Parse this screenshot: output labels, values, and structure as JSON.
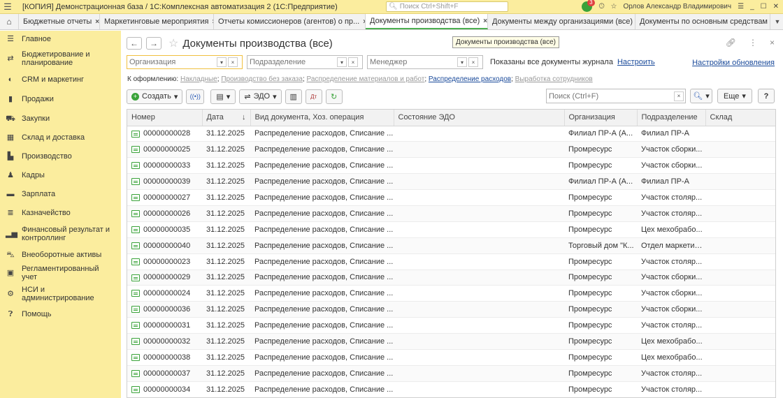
{
  "titlebar": {
    "menu_icon": "hamburger-icon",
    "title": "[КОПИЯ] Демонстрационная база / 1С:Комплексная автоматизация 2  (1С:Предприятие)",
    "search_placeholder": "Поиск Ctrl+Shift+F",
    "notifications_count": "3",
    "user": "Орлов Александр Владимирович"
  },
  "tabs": {
    "items": [
      {
        "label": "Бюджетные отчеты"
      },
      {
        "label": "Маркетинговые мероприятия"
      },
      {
        "label": "Отчеты комиссионеров (агентов) о пр..."
      },
      {
        "label": "Документы производства (все)"
      },
      {
        "label": "Документы между организациями (все)"
      },
      {
        "label": "Документы по основным средствам"
      }
    ],
    "active_index": 3
  },
  "sidebar": {
    "items": [
      {
        "label": "Главное",
        "icon": "menu-icon"
      },
      {
        "label": "Бюджетирование и планирование",
        "icon": "budget-icon"
      },
      {
        "label": "CRM и маркетинг",
        "icon": "crm-icon"
      },
      {
        "label": "Продажи",
        "icon": "sales-icon"
      },
      {
        "label": "Закупки",
        "icon": "cart-icon"
      },
      {
        "label": "Склад и доставка",
        "icon": "warehouse-icon"
      },
      {
        "label": "Производство",
        "icon": "factory-icon"
      },
      {
        "label": "Кадры",
        "icon": "person-icon"
      },
      {
        "label": "Зарплата",
        "icon": "wallet-icon"
      },
      {
        "label": "Казначейство",
        "icon": "treasury-icon"
      },
      {
        "label": "Финансовый результат и контроллинг",
        "icon": "chart-icon"
      },
      {
        "label": "Внеоборотные активы",
        "icon": "assets-icon"
      },
      {
        "label": "Регламентированный учет",
        "icon": "calculator-icon"
      },
      {
        "label": "НСИ и администрирование",
        "icon": "gear-icon"
      },
      {
        "label": "Помощь",
        "icon": "help-icon"
      }
    ]
  },
  "header": {
    "title": "Документы производства (все)",
    "tooltip": "Документы производства (все)"
  },
  "filters": {
    "organization_placeholder": "Организация",
    "department_placeholder": "Подразделение",
    "manager_placeholder": "Менеджер",
    "shown_text": "Показаны все документы журнала",
    "configure_link": "Настроить",
    "update_settings_link": "Настройки обновления"
  },
  "process": {
    "label": "К оформлению:",
    "items": [
      {
        "text": "Накладные"
      },
      {
        "text": "Производство без заказа"
      },
      {
        "text": "Распределение материалов и работ"
      },
      {
        "text": "Распределение расходов"
      },
      {
        "text": "Выработка сотрудников"
      }
    ],
    "active_index": 3
  },
  "toolbar": {
    "create_label": "Создать",
    "edo_label": "ЭДО",
    "search_placeholder": "Поиск (Ctrl+F)",
    "more_label": "Еще",
    "help_label": "?"
  },
  "table": {
    "columns": [
      "Номер",
      "Дата",
      "Вид документа, Хоз. операция",
      "Состояние ЭДО",
      "Организация",
      "Подразделение",
      "Склад"
    ],
    "rows": [
      {
        "number": "00000000028",
        "date": "31.12.2025",
        "type": "Распределение расходов, Списание ...",
        "edo": "",
        "org": "Филиал ПР-А (А...",
        "dept": "Филиал ПР-А",
        "store": ""
      },
      {
        "number": "00000000025",
        "date": "31.12.2025",
        "type": "Распределение расходов, Списание ...",
        "edo": "",
        "org": "Промресурс",
        "dept": "Участок сборки...",
        "store": ""
      },
      {
        "number": "00000000033",
        "date": "31.12.2025",
        "type": "Распределение расходов, Списание ...",
        "edo": "",
        "org": "Промресурс",
        "dept": "Участок сборки...",
        "store": ""
      },
      {
        "number": "00000000039",
        "date": "31.12.2025",
        "type": "Распределение расходов, Списание ...",
        "edo": "",
        "org": "Филиал ПР-А (А...",
        "dept": "Филиал ПР-А",
        "store": ""
      },
      {
        "number": "00000000027",
        "date": "31.12.2025",
        "type": "Распределение расходов, Списание ...",
        "edo": "",
        "org": "Промресурс",
        "dept": "Участок столяр...",
        "store": ""
      },
      {
        "number": "00000000026",
        "date": "31.12.2025",
        "type": "Распределение расходов, Списание ...",
        "edo": "",
        "org": "Промресурс",
        "dept": "Участок столяр...",
        "store": ""
      },
      {
        "number": "00000000035",
        "date": "31.12.2025",
        "type": "Распределение расходов, Списание ...",
        "edo": "",
        "org": "Промресурс",
        "dept": "Цех мехобрабо...",
        "store": ""
      },
      {
        "number": "00000000040",
        "date": "31.12.2025",
        "type": "Распределение расходов, Списание ...",
        "edo": "",
        "org": "Торговый дом \"К...",
        "dept": "Отдел маркетинга",
        "store": ""
      },
      {
        "number": "00000000023",
        "date": "31.12.2025",
        "type": "Распределение расходов, Списание ...",
        "edo": "",
        "org": "Промресурс",
        "dept": "Участок столяр...",
        "store": ""
      },
      {
        "number": "00000000029",
        "date": "31.12.2025",
        "type": "Распределение расходов, Списание ...",
        "edo": "",
        "org": "Промресурс",
        "dept": "Участок сборки...",
        "store": ""
      },
      {
        "number": "00000000024",
        "date": "31.12.2025",
        "type": "Распределение расходов, Списание ...",
        "edo": "",
        "org": "Промресурс",
        "dept": "Участок сборки...",
        "store": ""
      },
      {
        "number": "00000000036",
        "date": "31.12.2025",
        "type": "Распределение расходов, Списание ...",
        "edo": "",
        "org": "Промресурс",
        "dept": "Участок сборки...",
        "store": ""
      },
      {
        "number": "00000000031",
        "date": "31.12.2025",
        "type": "Распределение расходов, Списание ...",
        "edo": "",
        "org": "Промресурс",
        "dept": "Участок столяр...",
        "store": ""
      },
      {
        "number": "00000000032",
        "date": "31.12.2025",
        "type": "Распределение расходов, Списание ...",
        "edo": "",
        "org": "Промресурс",
        "dept": "Цех мехобрабо...",
        "store": ""
      },
      {
        "number": "00000000038",
        "date": "31.12.2025",
        "type": "Распределение расходов, Списание ...",
        "edo": "",
        "org": "Промресурс",
        "dept": "Цех мехобрабо...",
        "store": ""
      },
      {
        "number": "00000000037",
        "date": "31.12.2025",
        "type": "Распределение расходов, Списание ...",
        "edo": "",
        "org": "Промресурс",
        "dept": "Участок столяр...",
        "store": ""
      },
      {
        "number": "00000000034",
        "date": "31.12.2025",
        "type": "Распределение расходов, Списание ...",
        "edo": "",
        "org": "Промресурс",
        "dept": "Участок столяр...",
        "store": ""
      }
    ]
  },
  "colors": {
    "sidebar_bg": "#fbed9e",
    "accent_green": "#3aa33a",
    "link_blue": "#1a4a9a"
  }
}
